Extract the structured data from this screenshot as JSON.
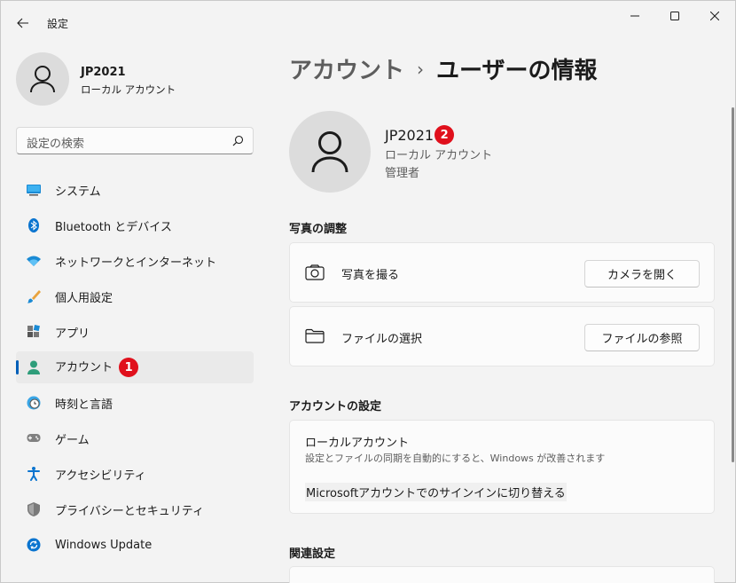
{
  "window": {
    "title": "設定",
    "back_icon": "back-arrow-icon",
    "minimize_icon": "minimize-icon",
    "maximize_icon": "maximize-icon",
    "close_icon": "close-icon"
  },
  "profile": {
    "name": "JP2021",
    "type": "ローカル アカウント"
  },
  "search": {
    "placeholder": "設定の検索",
    "icon": "search-icon"
  },
  "sidebar": {
    "items": [
      {
        "label": "システム",
        "icon": "system-icon"
      },
      {
        "label": "Bluetooth とデバイス",
        "icon": "bluetooth-icon"
      },
      {
        "label": "ネットワークとインターネット",
        "icon": "network-icon"
      },
      {
        "label": "個人用設定",
        "icon": "brush-icon"
      },
      {
        "label": "アプリ",
        "icon": "apps-icon"
      },
      {
        "label": "アカウント",
        "icon": "account-icon",
        "active": true,
        "marker": "1"
      },
      {
        "label": "時刻と言語",
        "icon": "time-language-icon"
      },
      {
        "label": "ゲーム",
        "icon": "gamepad-icon"
      },
      {
        "label": "アクセシビリティ",
        "icon": "accessibility-icon"
      },
      {
        "label": "プライバシーとセキュリティ",
        "icon": "shield-icon"
      },
      {
        "label": "Windows Update",
        "icon": "windows-update-icon"
      }
    ]
  },
  "breadcrumb": {
    "parent": "アカウント",
    "separator": "›",
    "current": "ユーザーの情報"
  },
  "user": {
    "name": "JP2021",
    "marker": "2",
    "type": "ローカル アカウント",
    "role": "管理者"
  },
  "photo_section": {
    "title": "写真の調整",
    "camera": {
      "label": "写真を撮る",
      "button": "カメラを開く",
      "icon": "camera-icon"
    },
    "file": {
      "label": "ファイルの選択",
      "button": "ファイルの参照",
      "icon": "folder-icon"
    }
  },
  "account_section": {
    "title": "アカウントの設定",
    "local_title": "ローカルアカウント",
    "local_desc": "設定とファイルの同期を自動的にすると、Windows が改善されます",
    "switch_link": "Microsoftアカウントでのサインインに切り替える"
  },
  "related_section": {
    "title": "関連設定"
  },
  "colors": {
    "accent": "#005fb8",
    "marker": "#e0101c"
  }
}
